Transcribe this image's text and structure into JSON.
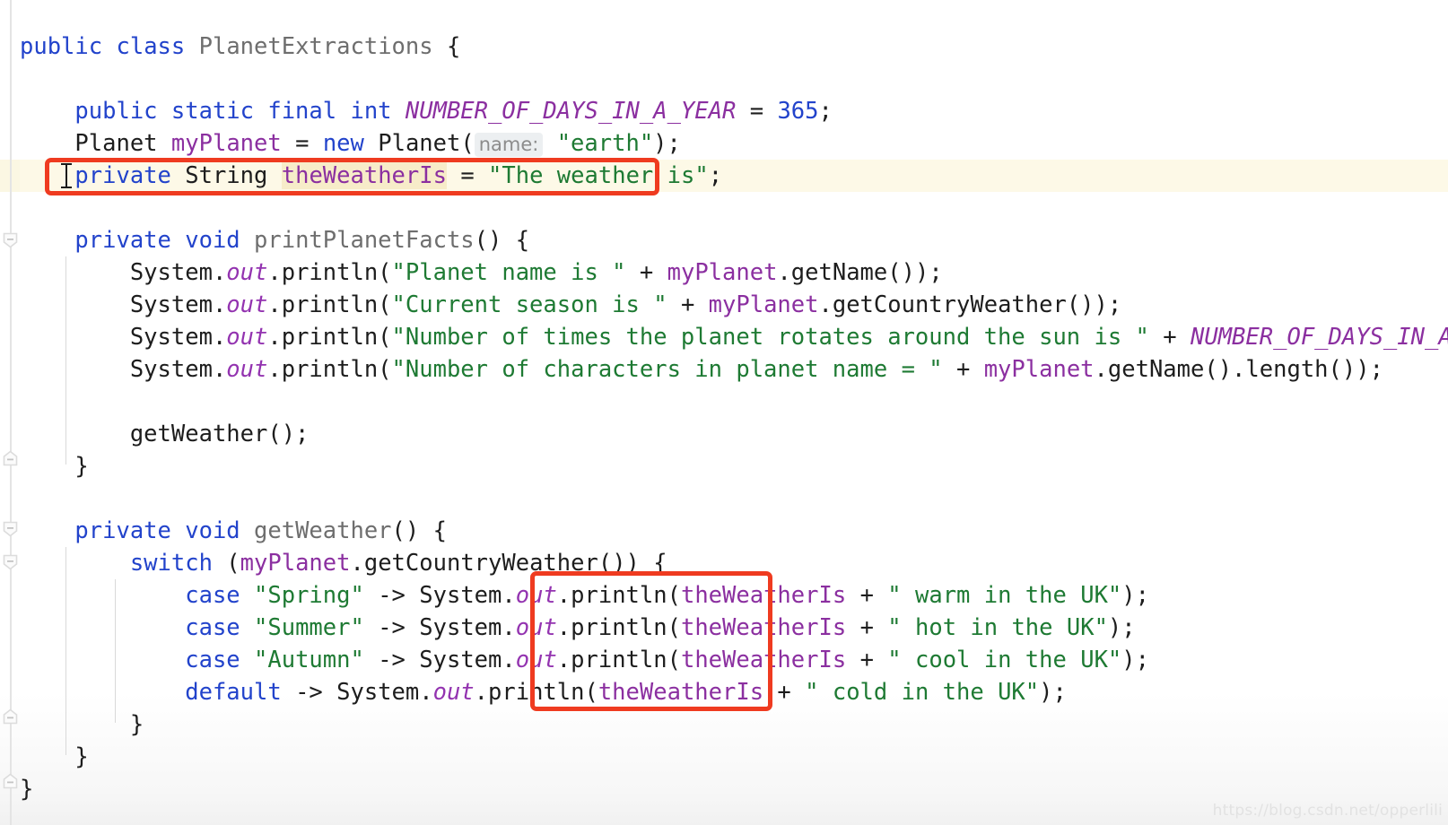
{
  "editor": {
    "language": "java",
    "theme": "IntelliJ Light",
    "file_class": "PlanetExtractions",
    "colors": {
      "background": "#ffffff",
      "keyword": "#2243cb",
      "string": "#1e7a33",
      "field": "#8b2fa0",
      "static_italic": "#9333b0",
      "class_name": "#6e6e6e",
      "plain_text": "#1d1d1d",
      "caret_row_highlight": "#fdf9e7",
      "occurrence_highlight": "#f7ecc9",
      "annotation_box": "#ef3b20",
      "gutter_line": "#e4e4e4",
      "indent_guide": "#d9d9d9",
      "inlay_hint_bg": "#eceff1",
      "inlay_hint_fg": "#8c8c8c"
    },
    "inlay_hint": "name:",
    "watermark": "https://blog.csdn.net/opperlili"
  },
  "code_lines": [
    {
      "n": 1,
      "indent": 0,
      "text": "public class PlanetExtractions {"
    },
    {
      "n": 2,
      "indent": 0,
      "text": ""
    },
    {
      "n": 3,
      "indent": 1,
      "text": "public static final int NUMBER_OF_DAYS_IN_A_YEAR = 365;"
    },
    {
      "n": 4,
      "indent": 1,
      "text": "Planet myPlanet = new Planet( name: \"earth\");"
    },
    {
      "n": 5,
      "indent": 1,
      "text": "private String theWeatherIs = \"The weather is\";"
    },
    {
      "n": 6,
      "indent": 0,
      "text": ""
    },
    {
      "n": 7,
      "indent": 1,
      "text": "private void printPlanetFacts() {"
    },
    {
      "n": 8,
      "indent": 2,
      "text": "System.out.println(\"Planet name is \" + myPlanet.getName());"
    },
    {
      "n": 9,
      "indent": 2,
      "text": "System.out.println(\"Current season is \" + myPlanet.getCountryWeather());"
    },
    {
      "n": 10,
      "indent": 2,
      "text": "System.out.println(\"Number of times the planet rotates around the sun is \" + NUMBER_OF_DAYS_IN_A_YEAR);"
    },
    {
      "n": 11,
      "indent": 2,
      "text": "System.out.println(\"Number of characters in planet name = \" + myPlanet.getName().length());"
    },
    {
      "n": 12,
      "indent": 0,
      "text": ""
    },
    {
      "n": 13,
      "indent": 2,
      "text": "getWeather();"
    },
    {
      "n": 14,
      "indent": 1,
      "text": "}"
    },
    {
      "n": 15,
      "indent": 0,
      "text": ""
    },
    {
      "n": 16,
      "indent": 1,
      "text": "private void getWeather() {"
    },
    {
      "n": 17,
      "indent": 2,
      "text": "switch (myPlanet.getCountryWeather()) {"
    },
    {
      "n": 18,
      "indent": 3,
      "text": "case \"Spring\" -> System.out.println(theWeatherIs + \" warm in the UK\");"
    },
    {
      "n": 19,
      "indent": 3,
      "text": "case \"Summer\" -> System.out.println(theWeatherIs + \" hot in the UK\");"
    },
    {
      "n": 20,
      "indent": 3,
      "text": "case \"Autumn\" -> System.out.println(theWeatherIs + \" cool in the UK\");"
    },
    {
      "n": 21,
      "indent": 3,
      "text": "default -> System.out.println(theWeatherIs + \" cold in the UK\");"
    },
    {
      "n": 22,
      "indent": 2,
      "text": "}"
    },
    {
      "n": 23,
      "indent": 1,
      "text": "}"
    },
    {
      "n": 24,
      "indent": 0,
      "text": "}"
    }
  ],
  "tokens": {
    "l1": {
      "kw_public": "public",
      "kw_class": "class",
      "name": "PlanetExtractions",
      "brace": "{"
    },
    "l3": {
      "kw": "public static final int",
      "const": "NUMBER_OF_DAYS_IN_A_YEAR",
      "eq": "=",
      "num": "365",
      "semi": ";"
    },
    "l4": {
      "type": "Planet",
      "var": "myPlanet",
      "eq": "=",
      "kw_new": "new",
      "ctor": "Planet(",
      "hint": "name:",
      "str": "\"earth\"",
      "tail": ");"
    },
    "l5": {
      "kw_private": "private",
      "type": "String",
      "field": "theWeatherIs",
      "eq": "=",
      "str": "\"The weather is\"",
      "semi": ";"
    },
    "l7": {
      "kw": "private void",
      "method": "printPlanetFacts",
      "tail": "() {"
    },
    "l8": {
      "recv": "System.",
      "out": "out",
      "call": ".println(",
      "str": "\"Planet name is \"",
      "plus": "+",
      "var": "myPlanet",
      "tail": ".getName());"
    },
    "l9": {
      "recv": "System.",
      "out": "out",
      "call": ".println(",
      "str": "\"Current season is \"",
      "plus": "+",
      "var": "myPlanet",
      "tail": ".getCountryWeather());"
    },
    "l10": {
      "recv": "System.",
      "out": "out",
      "call": ".println(",
      "str": "\"Number of times the planet rotates around the sun is \"",
      "plus": "+",
      "const": "NUMBER_OF_DAYS_IN_A_YEAR",
      "tail": ");"
    },
    "l11": {
      "recv": "System.",
      "out": "out",
      "call": ".println(",
      "str": "\"Number of characters in planet name = \"",
      "plus": "+",
      "var": "myPlanet",
      "tail": ".getName().length());"
    },
    "l13": {
      "call": "getWeather();"
    },
    "l16": {
      "kw": "private void",
      "method": "getWeather",
      "tail": "() {"
    },
    "l17": {
      "kw_switch": "switch",
      "open": " (",
      "var": "myPlanet",
      "tail": ".getCountryWeather()) {"
    },
    "l18": {
      "kw_case": "case",
      "str_case": "\"Spring\"",
      "arrow": "-> System.",
      "out": "out",
      "call": ".println(",
      "field": "theWeatherIs",
      "plus": "+",
      "str": "\" warm in the UK\"",
      "tail": ");"
    },
    "l19": {
      "kw_case": "case",
      "str_case": "\"Summer\"",
      "arrow": "-> System.",
      "out": "out",
      "call": ".println(",
      "field": "theWeatherIs",
      "plus": "+",
      "str": "\" hot in the UK\"",
      "tail": ");"
    },
    "l20": {
      "kw_case": "case",
      "str_case": "\"Autumn\"",
      "arrow": "-> System.",
      "out": "out",
      "call": ".println(",
      "field": "theWeatherIs",
      "plus": "+",
      "str": "\" cool in the UK\"",
      "tail": ");"
    },
    "l21": {
      "kw_default": "default",
      "arrow": "-> System.",
      "out": "out",
      "call": ".println(",
      "field": "theWeatherIs",
      "plus": "+",
      "str": "\" cold in the UK\"",
      "tail": ");"
    },
    "brace": "}"
  },
  "annotations": [
    {
      "id": "field-declaration-box",
      "label": "red box around field declaration line"
    },
    {
      "id": "field-usages-box",
      "label": "red box around theWeatherIs usages in switch"
    }
  ],
  "fold_markers": [
    {
      "id": "fold-printPlanetFacts-start",
      "state": "expanded"
    },
    {
      "id": "fold-printPlanetFacts-end",
      "state": "expanded"
    },
    {
      "id": "fold-getWeather-start",
      "state": "expanded"
    },
    {
      "id": "fold-switch-start",
      "state": "expanded"
    },
    {
      "id": "fold-switch-end",
      "state": "expanded"
    },
    {
      "id": "fold-class-end",
      "state": "expanded"
    }
  ]
}
